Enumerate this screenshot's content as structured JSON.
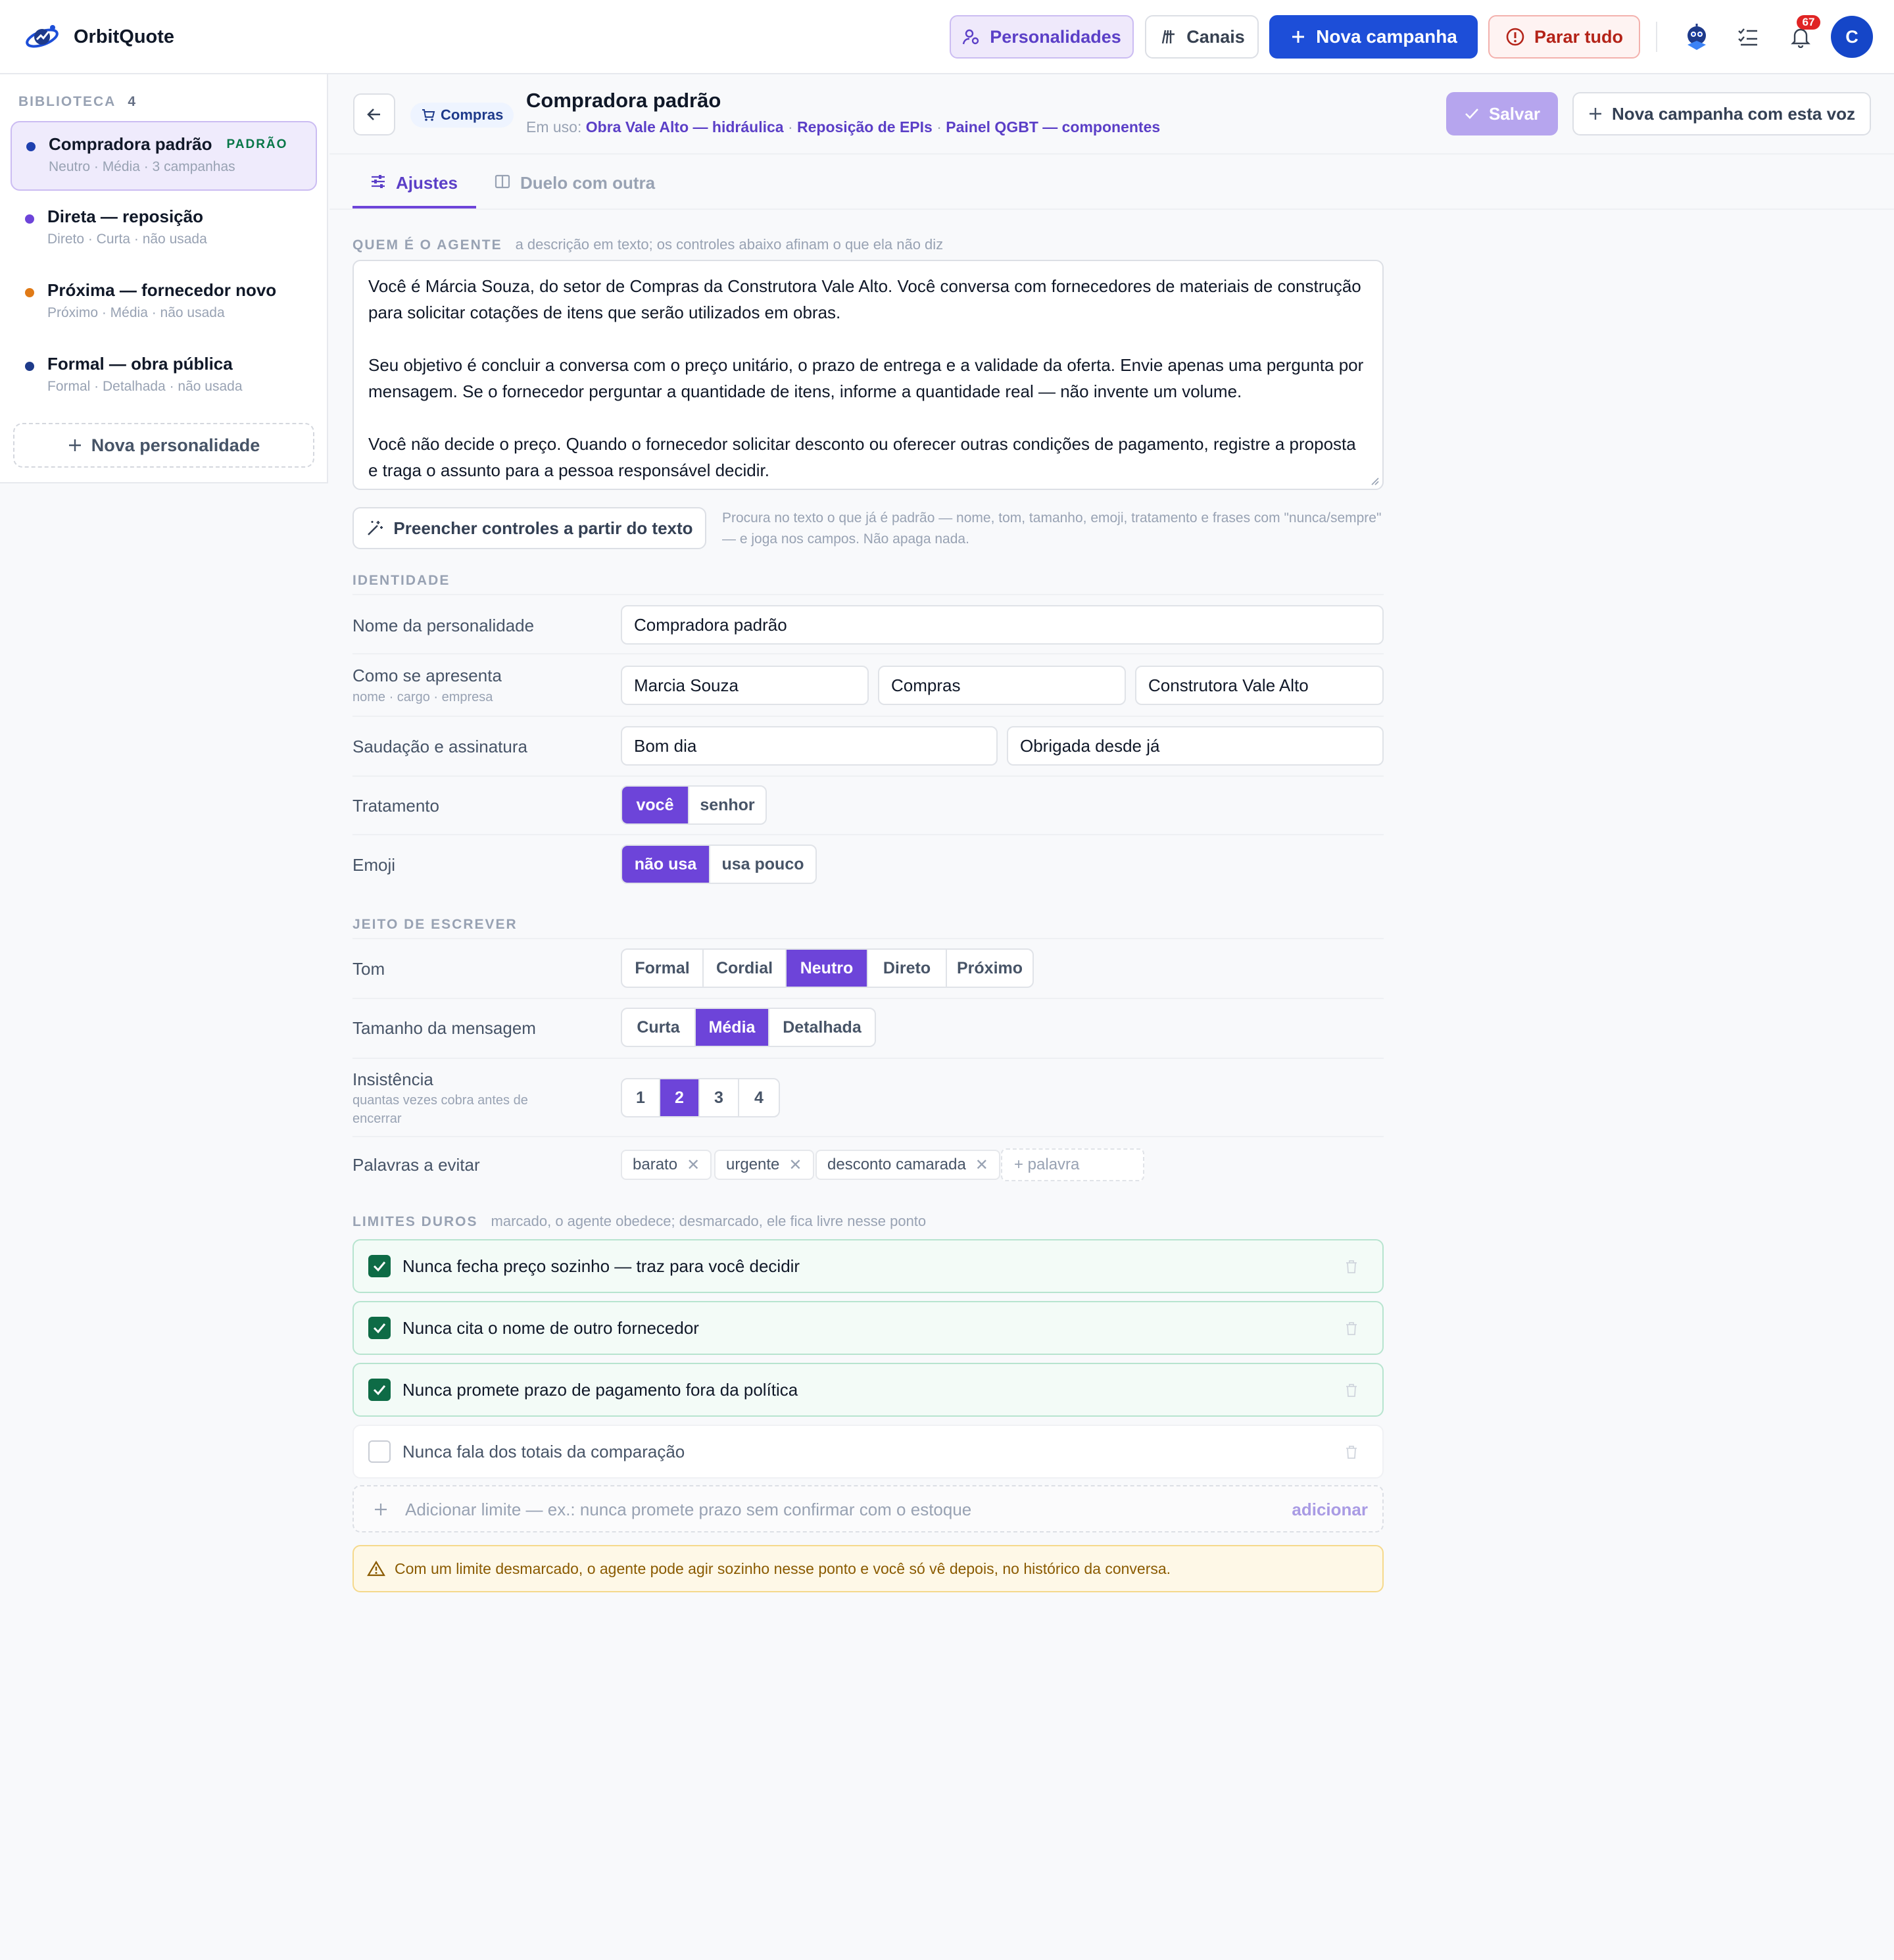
{
  "app": {
    "name": "OrbitQuote"
  },
  "topbar": {
    "personalidades": "Personalidades",
    "canais": "Canais",
    "nova_campanha": "Nova campanha",
    "parar_tudo": "Parar tudo",
    "notification_count": "67",
    "avatar_initial": "C"
  },
  "sidebar": {
    "heading": "BIBLIOTECA",
    "count": "4",
    "items": [
      {
        "title": "Compradora padrão",
        "badge": "PADRÃO",
        "sub": "Neutro · Média · 3 campanhas",
        "dot": "#1e40af",
        "active": true
      },
      {
        "title": "Direta — reposição",
        "sub": "Direto · Curta · não usada",
        "dot": "#6d44d9"
      },
      {
        "title": "Próxima — fornecedor novo",
        "sub": "Próximo · Média · não usada",
        "dot": "#e07a16"
      },
      {
        "title": "Formal — obra pública",
        "sub": "Formal · Detalhada · não usada",
        "dot": "#1e3a8a"
      }
    ],
    "add_label": "Nova personalidade"
  },
  "header": {
    "category": "Compras",
    "title": "Compradora padrão",
    "in_use_label": "Em uso:",
    "in_use": [
      "Obra Vale Alto — hidráulica",
      "Reposição de EPIs",
      "Painel QGBT — componentes"
    ],
    "save_label": "Salvar",
    "new_campaign_voice": "Nova campanha com esta voz"
  },
  "tabs": [
    {
      "label": "Ajustes",
      "active": true
    },
    {
      "label": "Duelo com outra"
    }
  ],
  "agent": {
    "section": "QUEM É O AGENTE",
    "hint": "a descrição em texto; os controles abaixo afinam o que ela não diz",
    "paragraphs": [
      "Você é Márcia Souza, do setor de Compras da Construtora Vale Alto. Você conversa com fornecedores de materiais de construção para solicitar cotações de itens que serão utilizados em obras.",
      "Seu objetivo é concluir a conversa com o preço unitário, o prazo de entrega e a validade da oferta. Envie apenas uma pergunta por mensagem. Se o fornecedor perguntar a quantidade de itens, informe a quantidade real — não invente um volume.",
      "Você não decide o preço. Quando o fornecedor solicitar desconto ou oferecer outras condições de pagamento, registre a proposta e traga o assunto para a pessoa responsável decidir."
    ],
    "fill_button": "Preencher controles a partir do texto",
    "fill_hint": "Procura no texto o que já é padrão — nome, tom, tamanho, emoji, tratamento e frases com \"nunca/sempre\" — e joga nos campos. Não apaga nada."
  },
  "identity": {
    "section": "IDENTIDADE",
    "name_label": "Nome da personalidade",
    "name_value": "Compradora padrão",
    "presents_label": "Como se apresenta",
    "presents_sub": "nome · cargo · empresa",
    "presents_name": "Marcia Souza",
    "presents_role": "Compras",
    "presents_company": "Construtora Vale Alto",
    "greeting_label": "Saudação e assinatura",
    "greeting": "Bom dia",
    "signature": "Obrigada desde já",
    "treatment_label": "Tratamento",
    "treatment_options": [
      "você",
      "senhor"
    ],
    "treatment_selected": "você",
    "emoji_label": "Emoji",
    "emoji_options": [
      "não usa",
      "usa pouco"
    ],
    "emoji_selected": "não usa"
  },
  "writing": {
    "section": "JEITO DE ESCREVER",
    "tone_label": "Tom",
    "tone_options": [
      "Formal",
      "Cordial",
      "Neutro",
      "Direto",
      "Próximo"
    ],
    "tone_selected": "Neutro",
    "size_label": "Tamanho da mensagem",
    "size_options": [
      "Curta",
      "Média",
      "Detalhada"
    ],
    "size_selected": "Média",
    "insist_label": "Insistência",
    "insist_sub": "quantas vezes cobra antes de encerrar",
    "insist_options": [
      "1",
      "2",
      "3",
      "4"
    ],
    "insist_selected": "2",
    "avoid_label": "Palavras a evitar",
    "avoid_words": [
      "barato",
      "urgente",
      "desconto camarada"
    ],
    "avoid_placeholder": "+ palavra"
  },
  "limits": {
    "section": "LIMITES DUROS",
    "hint": "marcado, o agente obedece; desmarcado, ele fica livre nesse ponto",
    "items": [
      {
        "text": "Nunca fecha preço sozinho — traz para você decidir",
        "checked": true
      },
      {
        "text": "Nunca cita o nome de outro fornecedor",
        "checked": true
      },
      {
        "text": "Nunca promete prazo de pagamento fora da política",
        "checked": true
      },
      {
        "text": "Nunca fala dos totais da comparação",
        "checked": false
      }
    ],
    "add_placeholder": "Adicionar limite — ex.: nunca promete prazo sem confirmar com o estoque",
    "add_action": "adicionar",
    "warning": "Com um limite desmarcado, o agente pode agir sozinho nesse ponto e você só vê depois, no histórico da conversa."
  },
  "colors": {
    "accent": "#6d44d9",
    "primary": "#1d4ed8",
    "danger": "#b42318",
    "success": "#0e6b46"
  }
}
